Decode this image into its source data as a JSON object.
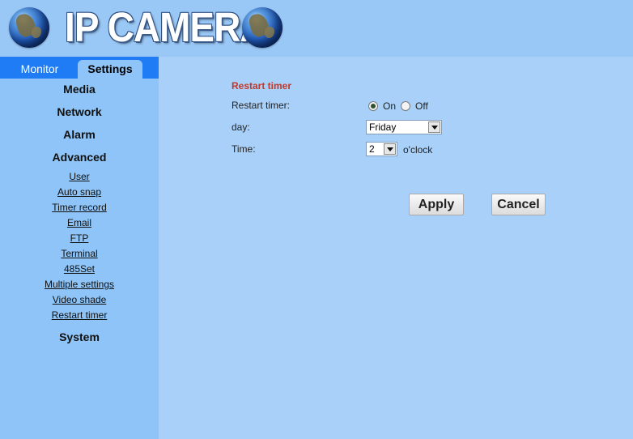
{
  "header": {
    "title": "IP CAMERA",
    "left_icon": "globe-icon",
    "right_icon": "globe-icon"
  },
  "tabs": {
    "monitor": "Monitor",
    "settings": "Settings"
  },
  "sidebar": {
    "sections": {
      "media": "Media",
      "network": "Network",
      "alarm": "Alarm",
      "advanced": "Advanced",
      "system": "System"
    },
    "advanced_items": [
      "User",
      "Auto snap",
      "Timer record",
      "Email",
      "FTP",
      "Terminal",
      "485Set",
      "Multiple settings",
      "Video shade",
      "Restart timer"
    ]
  },
  "form": {
    "section_title": "Restart timer",
    "restart_label": "Restart timer:",
    "on_label": "On",
    "off_label": "Off",
    "restart_value": "On",
    "day_label": "day:",
    "day_value": "Friday",
    "time_label": "Time:",
    "time_value": "2",
    "time_unit": "o'clock"
  },
  "buttons": {
    "apply": "Apply",
    "cancel": "Cancel"
  },
  "colors": {
    "header_bg": "#9ac8f6",
    "tab_bar": "#1f7cf4",
    "sidebar_bg": "#8ec4f7",
    "main_bg": "#a8d0f8",
    "section_title": "#c0392b"
  }
}
